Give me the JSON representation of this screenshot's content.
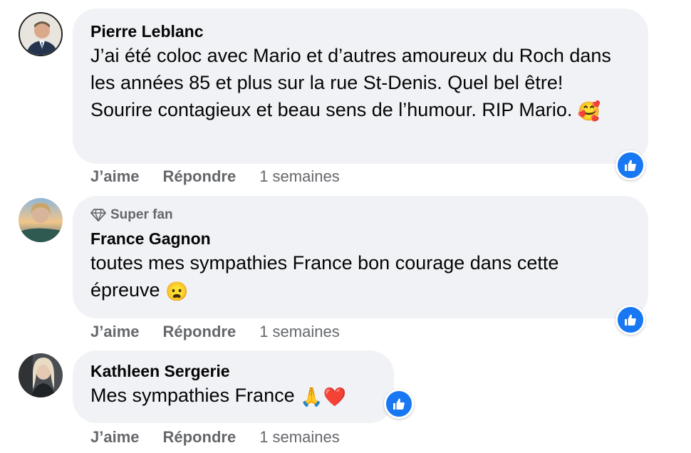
{
  "comments": [
    {
      "author": "Pierre Leblanc",
      "text": "J’ai été coloc avec Mario et d’autres amoureux du Roch dans les années 85 et plus sur la rue St-Denis. Quel bel être! Sourire contagieux et beau sens de l’humour. RIP Mario.",
      "emoji": "🥰",
      "like_label": "J’aime",
      "reply_label": "Répondre",
      "time": "1 semaines",
      "reaction_icon": "thumbs-up-icon"
    },
    {
      "badge": "Super fan",
      "badge_icon": "diamond-icon",
      "author": "France Gagnon",
      "text": "toutes mes sympathies France bon courage dans cette épreuve",
      "emoji": "😦",
      "like_label": "J’aime",
      "reply_label": "Répondre",
      "time": "1 semaines",
      "reaction_icon": "thumbs-up-icon"
    },
    {
      "author": "Kathleen Sergerie",
      "text": "Mes sympathies France",
      "emoji": "🙏❤️",
      "like_label": "J’aime",
      "reply_label": "Répondre",
      "time": "1 semaines",
      "reaction_icon": "thumbs-up-icon"
    }
  ],
  "colors": {
    "bubble": "#f0f2f5",
    "secondary_text": "#65676b",
    "like_blue": "#1877f2"
  }
}
